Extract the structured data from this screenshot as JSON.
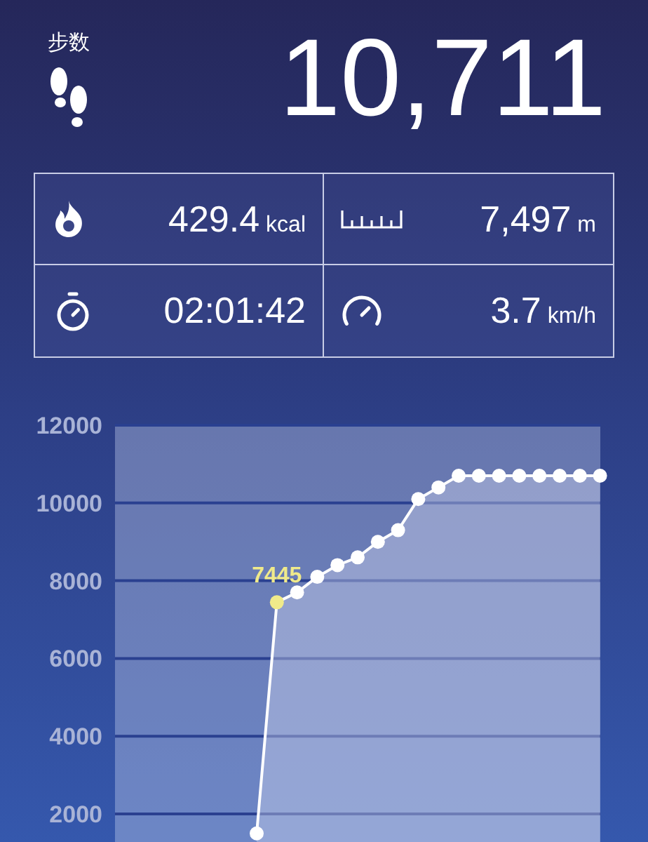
{
  "steps": {
    "label": "步数",
    "value": "10,711"
  },
  "stats": [
    {
      "kind": "calories",
      "value": "429.4",
      "unit": "kcal"
    },
    {
      "kind": "distance",
      "value": "7,497",
      "unit": "m"
    },
    {
      "kind": "duration",
      "value": "02:01:42"
    },
    {
      "kind": "speed",
      "value": "3.7",
      "unit": "km/h"
    }
  ],
  "chart_data": {
    "type": "area",
    "ylim": [
      0,
      12000
    ],
    "yticks": [
      2000,
      4000,
      6000,
      8000,
      10000,
      12000
    ],
    "grid": true,
    "values": [
      1500,
      7445,
      7700,
      8100,
      8400,
      8600,
      9000,
      9300,
      10100,
      10400,
      10700,
      10700,
      10700,
      10700,
      10700,
      10700,
      10700,
      10700
    ],
    "value_labels": [
      null,
      "7445",
      null,
      null,
      null,
      null,
      null,
      null,
      null,
      null,
      null,
      null,
      null,
      null,
      null,
      null,
      null,
      null
    ]
  }
}
